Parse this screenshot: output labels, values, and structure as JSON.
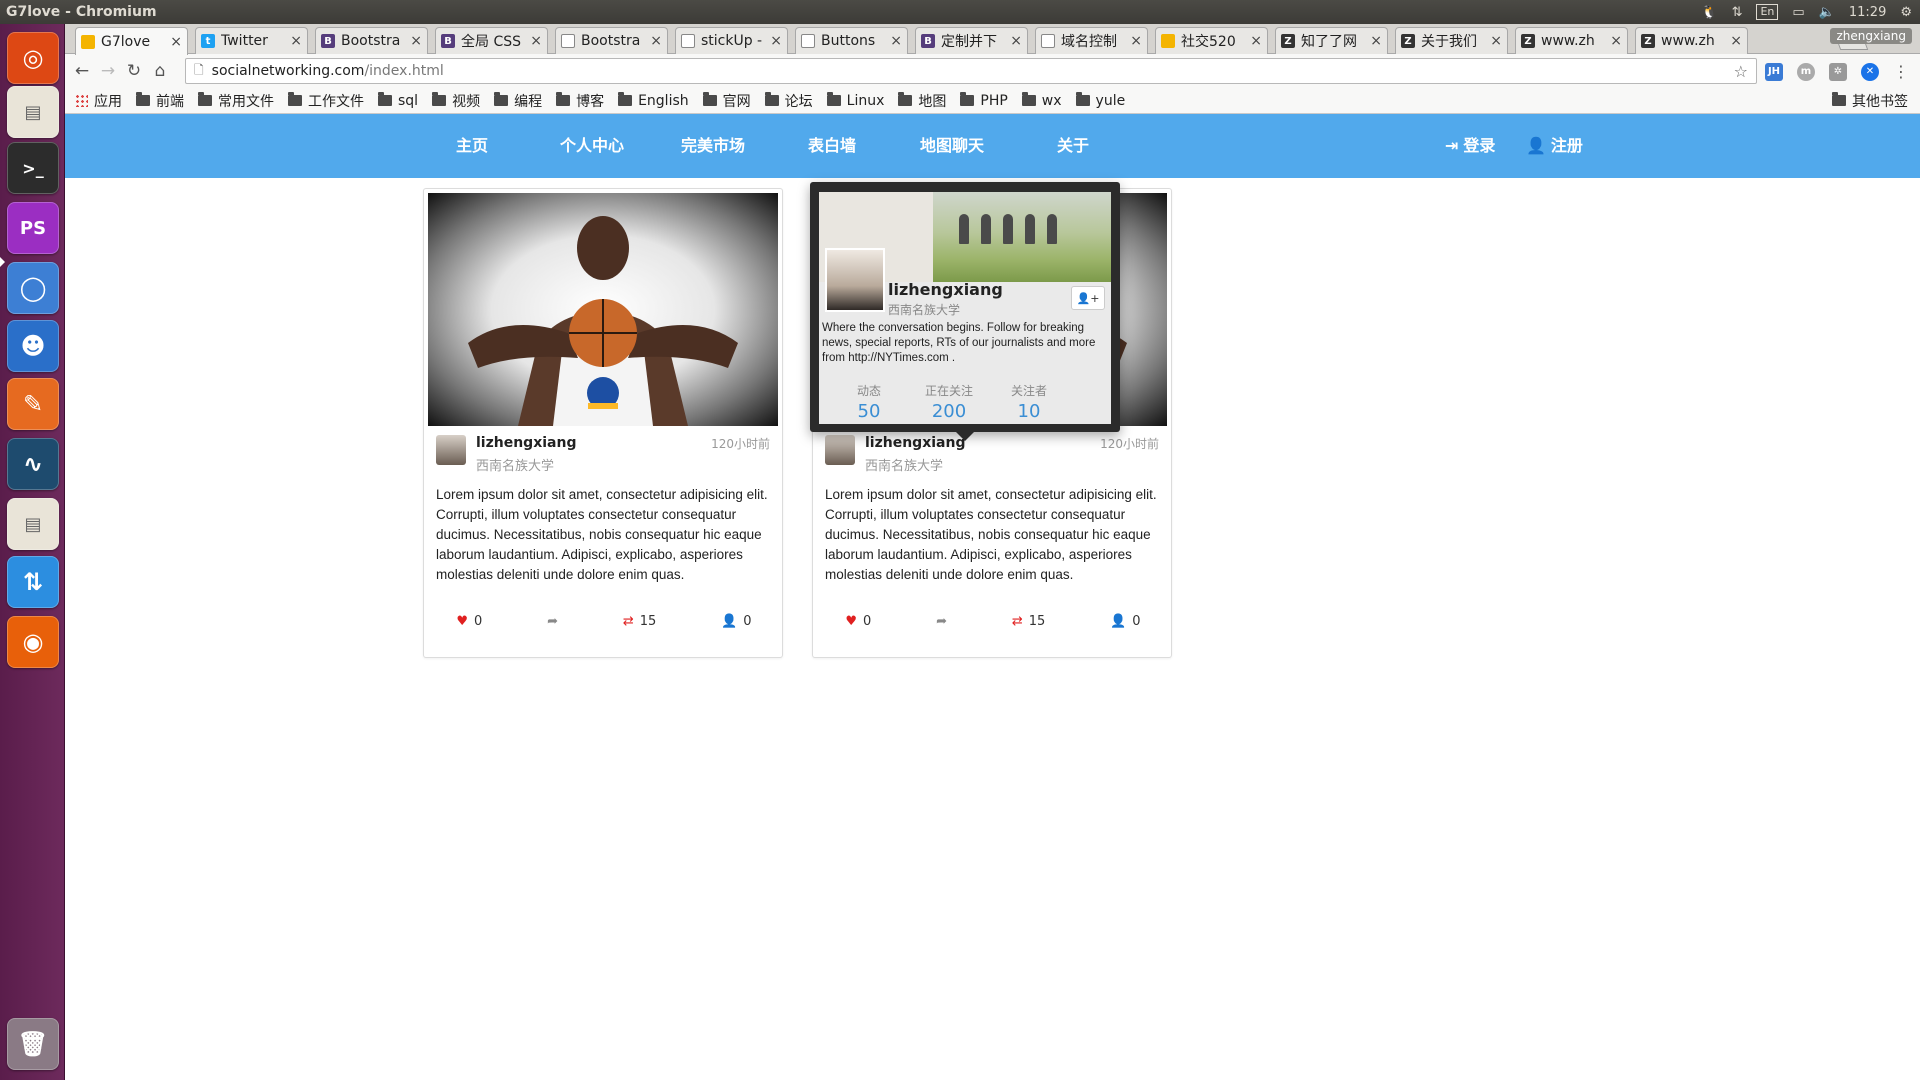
{
  "window": {
    "title": "G7love - Chromium"
  },
  "system": {
    "lang": "En",
    "time": "11:29",
    "user": "zhengxiang"
  },
  "tabs": [
    {
      "label": "G7love",
      "fav": "",
      "color": "#f4b400"
    },
    {
      "label": "Twitter",
      "fav": "t",
      "color": "#1da1f2"
    },
    {
      "label": "Bootstra",
      "fav": "B",
      "color": "#563d7c"
    },
    {
      "label": "全局 CSS",
      "fav": "B",
      "color": "#563d7c"
    },
    {
      "label": "Bootstra",
      "fav": "",
      "color": "#ffffff"
    },
    {
      "label": "stickUp -",
      "fav": "",
      "color": "#ffffff"
    },
    {
      "label": "Buttons",
      "fav": "",
      "color": "#ffffff"
    },
    {
      "label": "定制并下",
      "fav": "B",
      "color": "#563d7c"
    },
    {
      "label": "域名控制",
      "fav": "",
      "color": "#ffffff"
    },
    {
      "label": "社交520",
      "fav": "",
      "color": "#f4b400"
    },
    {
      "label": "知了了网",
      "fav": "Z",
      "color": "#333333"
    },
    {
      "label": "关于我们",
      "fav": "Z",
      "color": "#333333"
    },
    {
      "label": "www.zh",
      "fav": "Z",
      "color": "#333333"
    },
    {
      "label": "www.zh",
      "fav": "Z",
      "color": "#333333"
    }
  ],
  "address": {
    "host": "socialnetworking.com",
    "path": "/index.html"
  },
  "bookmarks": [
    "应用",
    "前端",
    "常用文件",
    "工作文件",
    "sql",
    "视频",
    "编程",
    "博客",
    "English",
    "官网",
    "论坛",
    "Linux",
    "地图",
    "PHP",
    "wx",
    "yule"
  ],
  "bookmarks_other": "其他书签",
  "site_nav": {
    "links": [
      "主页",
      "个人中心",
      "完美市场",
      "表白墙",
      "地图聊天",
      "关于"
    ],
    "login": "登录",
    "register": "注册"
  },
  "cards": [
    {
      "user": "lizhengxiang",
      "school": "西南名族大学",
      "time": "120小时前",
      "body": "Lorem ipsum dolor sit amet, consectetur adipisicing elit. Corrupti, illum voluptates consectetur consequatur ducimus. Necessitatibus, nobis consequatur hic eaque laborum laudantium. Adipisci, explicabo, asperiores molestias deleniti unde dolore enim quas.",
      "likes": "0",
      "retweets": "15",
      "followers": "0"
    },
    {
      "user": "lizhengxiang",
      "school": "西南名族大学",
      "time": "120小时前",
      "body": "Lorem ipsum dolor sit amet, consectetur adipisicing elit. Corrupti, illum voluptates consectetur consequatur ducimus. Necessitatibus, nobis consequatur hic eaque laborum laudantium. Adipisci, explicabo, asperiores molestias deleniti unde dolore enim quas.",
      "likes": "0",
      "retweets": "15",
      "followers": "0"
    }
  ],
  "popover": {
    "user": "lizhengxiang",
    "school": "西南名族大学",
    "bio": "Where the conversation begins. Follow for breaking news, special reports, RTs of our journalists and more from http://NYTimes.com .",
    "stats": [
      {
        "label": "动态",
        "value": "50"
      },
      {
        "label": "正在关注",
        "value": "200"
      },
      {
        "label": "关注者",
        "value": "10"
      }
    ]
  }
}
